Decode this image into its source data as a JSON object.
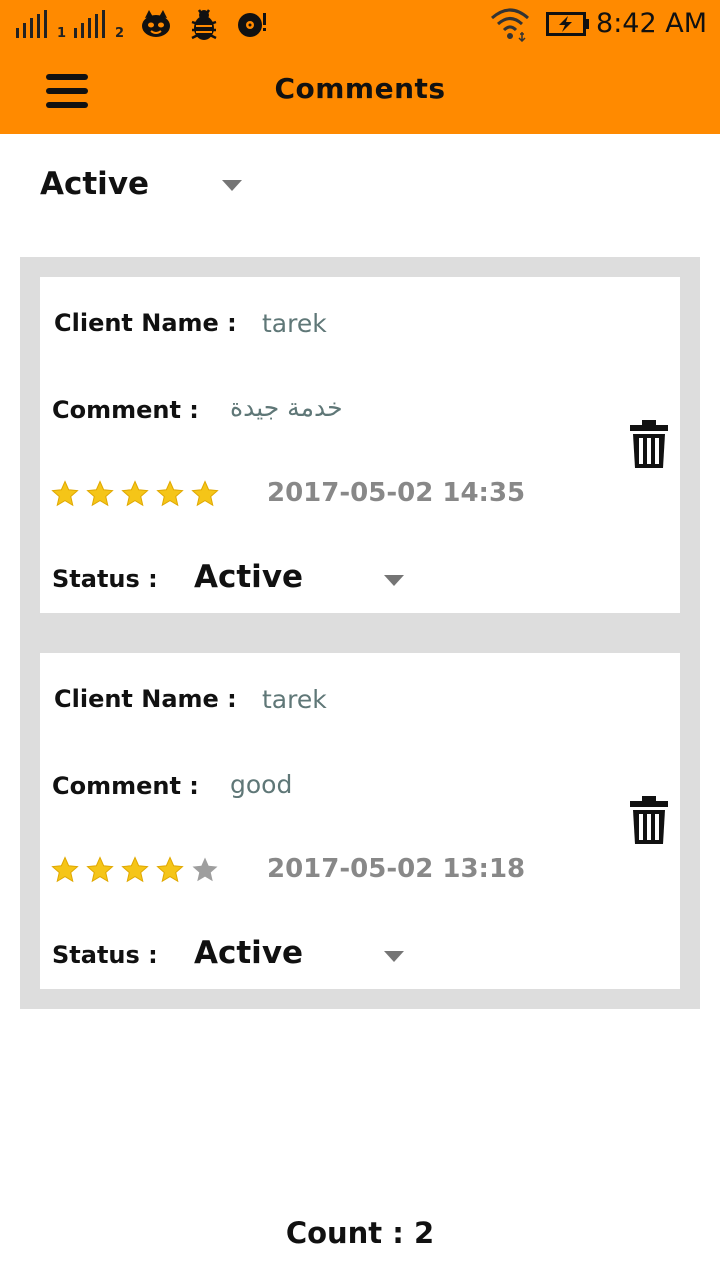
{
  "status_bar": {
    "sim1": "1",
    "sim2": "2",
    "time": "8:42 AM",
    "icons": [
      "signal-icon",
      "signal-icon",
      "cat-face-icon",
      "bug-icon",
      "vinyl-icon",
      "wifi-icon",
      "battery-charging-icon"
    ]
  },
  "app_bar": {
    "title": "Comments",
    "menu_icon": "hamburger-menu-icon",
    "color": "#ff8a00"
  },
  "filter": {
    "selected": "Active"
  },
  "labels": {
    "client_name": "Client Name :",
    "comment": "Comment :",
    "status": "Status :"
  },
  "comments": [
    {
      "client_name": "tarek",
      "comment": "خدمة جيدة",
      "rating": 5,
      "max_rating": 5,
      "date": "2017-05-02 14:35",
      "status": "Active"
    },
    {
      "client_name": "tarek",
      "comment": "good",
      "rating": 4,
      "max_rating": 5,
      "date": "2017-05-02 13:18",
      "status": "Active"
    }
  ],
  "footer": {
    "count_label": "Count :",
    "count": "2"
  },
  "colors": {
    "star_filled": "#f5c518",
    "star_empty": "#9e9e9e",
    "value_text": "#5f7777",
    "date_text": "#888888"
  }
}
